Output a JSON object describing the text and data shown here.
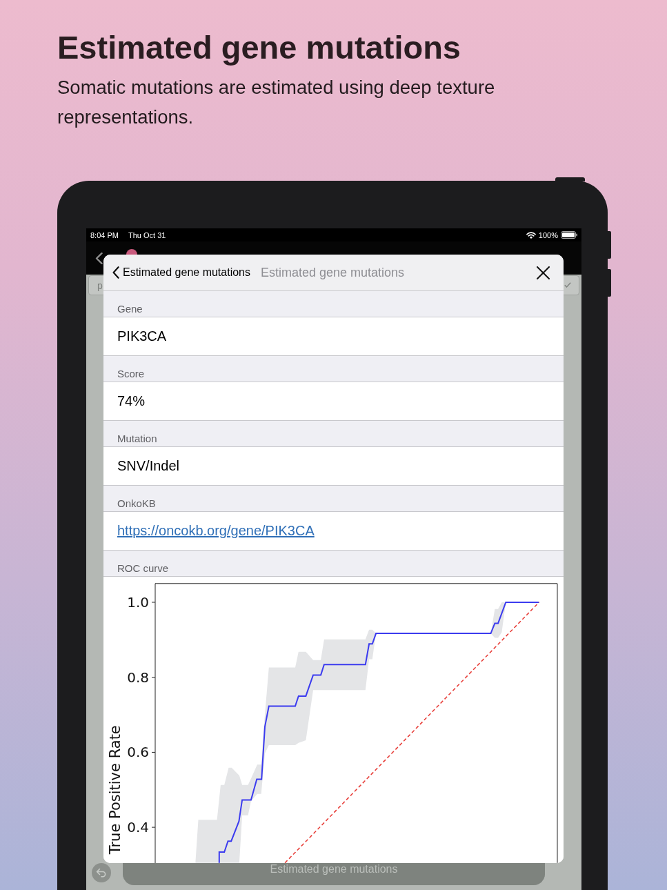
{
  "page": {
    "title": "Estimated gene mutations",
    "subtitle": "Somatic mutations are estimated using deep texture representations."
  },
  "status_bar": {
    "time": "8:04 PM",
    "date": "Thu Oct 31",
    "battery": "100%"
  },
  "search_field": {
    "placeholder": "p"
  },
  "sheet": {
    "back_label": "Estimated gene mutations",
    "title": "Estimated gene mutations",
    "fields": [
      {
        "kind": "text",
        "label": "Gene",
        "value": "PIK3CA"
      },
      {
        "kind": "text",
        "label": "Score",
        "value": "74%"
      },
      {
        "kind": "text",
        "label": "Mutation",
        "value": "SNV/Indel"
      },
      {
        "kind": "link",
        "label": "OnkoKB",
        "value": "https://oncokb.org/gene/PIK3CA"
      }
    ],
    "chart_section": {
      "label": "ROC curve",
      "roc_plot": {
        "y_axis_title": "True Positive Rate",
        "y_tick_labels": [
          "1.0",
          "0.8",
          "0.6",
          "0.4"
        ]
      }
    }
  },
  "bottom_bar": {
    "label": "Estimated gene mutations"
  }
}
